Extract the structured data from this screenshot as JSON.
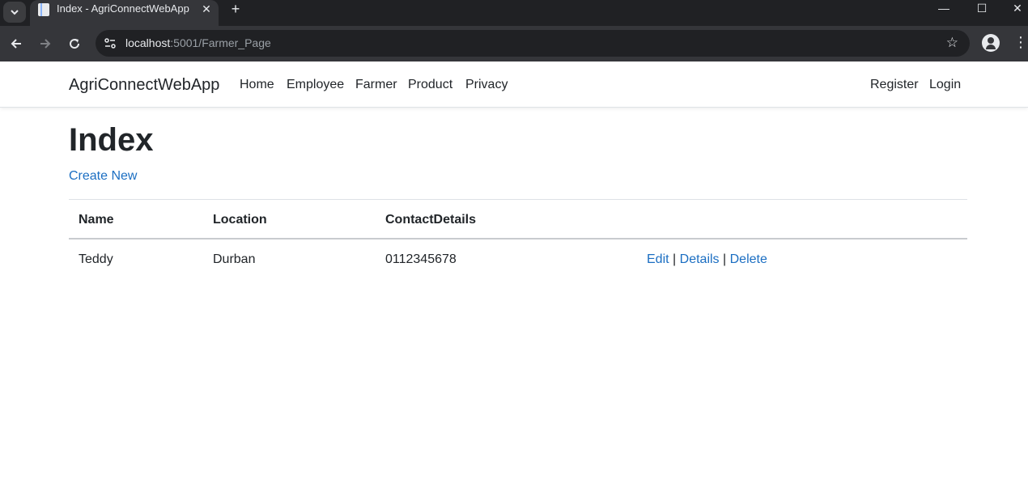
{
  "browser": {
    "tab_title": "Index - AgriConnectWebApp",
    "url_host": "localhost",
    "url_rest": ":5001/Farmer_Page"
  },
  "navbar": {
    "brand": "AgriConnectWebApp",
    "links": [
      "Home",
      "Employee",
      "Farmer",
      "Product",
      "Privacy"
    ],
    "right_links": [
      "Register",
      "Login"
    ]
  },
  "main": {
    "title": "Index",
    "create_link": "Create New",
    "table": {
      "headers": [
        "Name",
        "Location",
        "ContactDetails"
      ],
      "rows": [
        {
          "name": "Teddy",
          "location": "Durban",
          "contact": "0112345678",
          "actions": [
            "Edit",
            "Details",
            "Delete"
          ],
          "separator": "|"
        }
      ]
    }
  }
}
